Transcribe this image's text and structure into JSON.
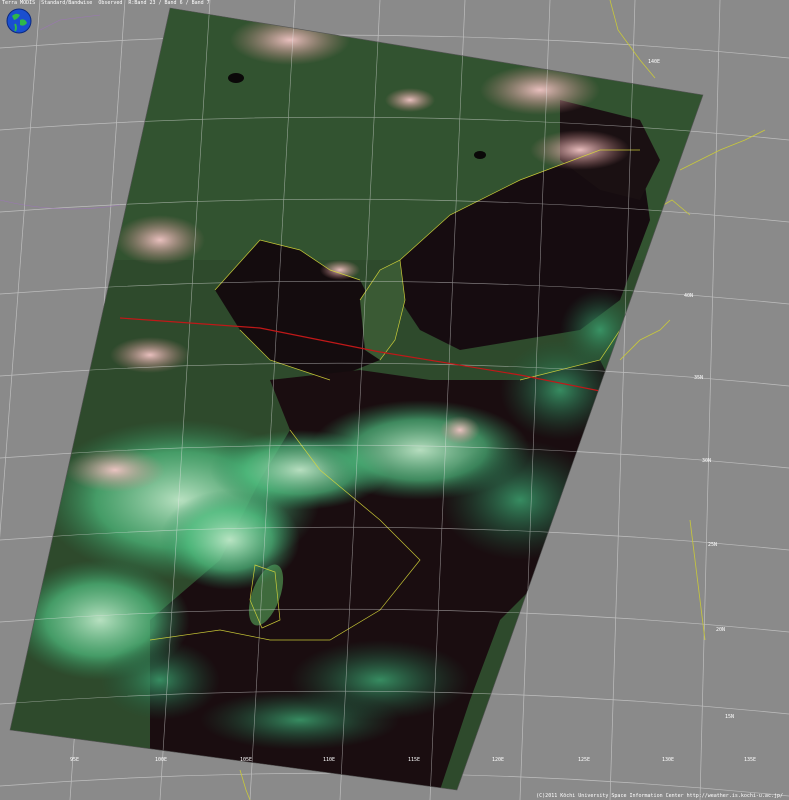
{
  "header": {
    "product": "Terra MODIS",
    "mode": "Standard/Bandwise",
    "composite": "Observed",
    "bands": "R:Band 23 / Band 6 / Band 7"
  },
  "image": {
    "scene": "MODIS false-colour swath over East Asia",
    "colors": {
      "background": "#8a8a8a",
      "graticule": "#d8d8d8",
      "coast": "#d8d83a",
      "border": "#9a5fb0",
      "track": "#c01818",
      "land": "#2e4a2c",
      "sea": "#140c0e",
      "cloud_green": "#3fb07a",
      "cloud_pink": "#d9a0a0"
    }
  },
  "labels": [
    {
      "text": "140E"
    },
    {
      "text": "40N"
    },
    {
      "text": "35N"
    },
    {
      "text": "30N"
    },
    {
      "text": "25N"
    },
    {
      "text": "20N"
    },
    {
      "text": "15N"
    },
    {
      "text": "95E"
    },
    {
      "text": "100E"
    },
    {
      "text": "105E"
    },
    {
      "text": "110E"
    },
    {
      "text": "115E"
    },
    {
      "text": "120E"
    },
    {
      "text": "125E"
    },
    {
      "text": "130E"
    },
    {
      "text": "135E"
    }
  ],
  "footer": {
    "credit": "(C)2011 Kōchi University Space Information Center  http://weather.is.kochi-u.ac.jp/"
  }
}
